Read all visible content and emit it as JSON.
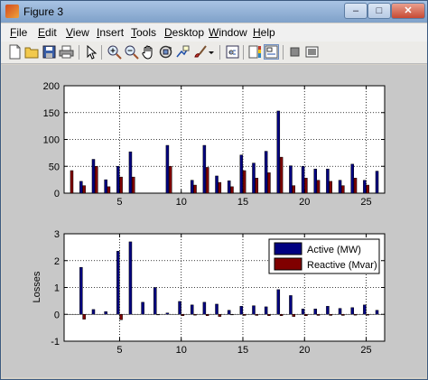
{
  "window": {
    "title": "Figure 3",
    "controls": {
      "minimize": "–",
      "maximize": "□",
      "close": "✕"
    }
  },
  "menu": [
    "File",
    "Edit",
    "View",
    "Insert",
    "Tools",
    "Desktop",
    "Window",
    "Help"
  ],
  "menu_accel": [
    "F",
    "E",
    "V",
    "I",
    "T",
    "D",
    "W",
    "H"
  ],
  "toolbar_icons": [
    "new-figure-icon",
    "open-file-icon",
    "save-icon",
    "print-icon",
    "edit-plot-arrow-icon",
    "zoom-in-icon",
    "zoom-out-icon",
    "pan-hand-icon",
    "rotate-3d-icon",
    "data-cursor-icon",
    "brush-icon",
    "link-plot-icon",
    "insert-colorbar-icon",
    "insert-legend-icon",
    "hide-plot-tools-icon",
    "show-plot-tools-icon"
  ],
  "colors": {
    "active": "#000080",
    "reactive": "#800000",
    "axes_bg": "#ffffff",
    "figure_bg": "#c8c8c8"
  },
  "chart_data": [
    {
      "type": "bar",
      "title": "",
      "xlabel": "",
      "ylabel": "",
      "x": [
        1,
        2,
        3,
        4,
        5,
        6,
        7,
        8,
        9,
        10,
        11,
        12,
        13,
        14,
        15,
        16,
        17,
        18,
        19,
        20,
        21,
        22,
        23,
        24,
        25,
        26
      ],
      "series": [
        {
          "values": [
            0,
            22,
            63,
            25,
            50,
            77,
            0,
            0,
            89,
            0,
            24,
            89,
            32,
            23,
            71,
            56,
            78,
            153,
            51,
            50,
            45,
            45,
            24,
            54,
            24,
            41
          ]
        },
        {
          "values": [
            42,
            14,
            50,
            12,
            30,
            30,
            0,
            0,
            50,
            0,
            15,
            48,
            20,
            12,
            42,
            28,
            38,
            67,
            14,
            28,
            24,
            22,
            14,
            28,
            15,
            0
          ]
        }
      ],
      "xlim": [
        1,
        26
      ],
      "ylim": [
        0,
        200
      ],
      "yticks": [
        0,
        50,
        100,
        150,
        200
      ],
      "xticks": [
        5,
        10,
        15,
        20,
        25
      ],
      "grid": true
    },
    {
      "type": "bar",
      "title": "",
      "xlabel": "",
      "ylabel": "Losses",
      "x": [
        1,
        2,
        3,
        4,
        5,
        6,
        7,
        8,
        9,
        10,
        11,
        12,
        13,
        14,
        15,
        16,
        17,
        18,
        19,
        20,
        21,
        22,
        23,
        24,
        25,
        26
      ],
      "series": [
        {
          "name": "Active (MW)",
          "values": [
            0,
            1.75,
            0.18,
            0.1,
            2.35,
            2.7,
            0.45,
            1.0,
            0.05,
            0.48,
            0.35,
            0.45,
            0.38,
            0.15,
            0.3,
            0.32,
            0.28,
            0.92,
            0.7,
            0.2,
            0.2,
            0.3,
            0.22,
            0.25,
            0.35,
            0.15
          ]
        },
        {
          "name": "Reactive  (Mvar)",
          "values": [
            0,
            -0.18,
            0,
            0,
            -0.2,
            0,
            0,
            -0.02,
            0,
            -0.05,
            -0.03,
            -0.05,
            -0.08,
            -0.02,
            -0.04,
            -0.04,
            -0.05,
            -0.05,
            -0.08,
            -0.05,
            -0.04,
            -0.04,
            -0.04,
            -0.03,
            -0.03,
            0
          ]
        }
      ],
      "xlim": [
        1,
        26
      ],
      "ylim": [
        -1,
        3
      ],
      "yticks": [
        -1,
        0,
        1,
        2,
        3
      ],
      "xticks": [
        5,
        10,
        15,
        20,
        25
      ],
      "grid": true,
      "legend_position": "top-right"
    }
  ]
}
